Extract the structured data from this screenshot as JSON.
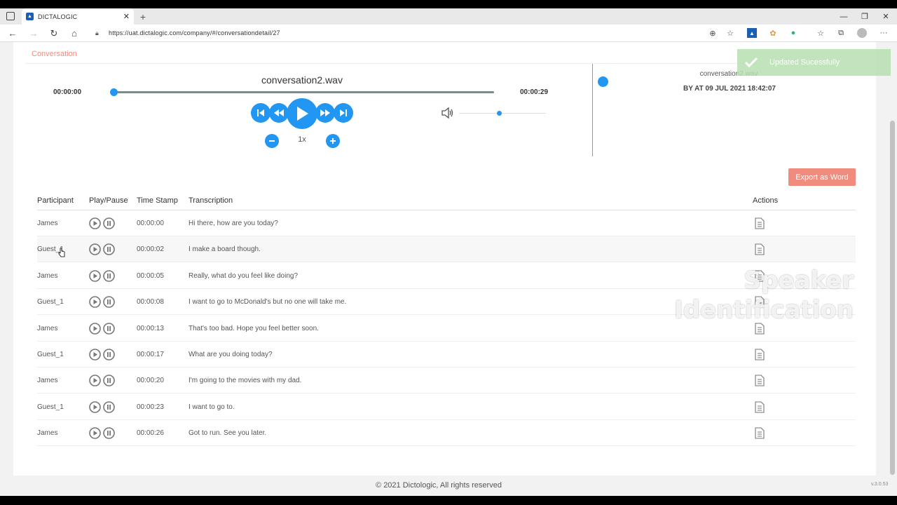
{
  "browser": {
    "tab_title": "DICTALOGIC",
    "url": "https://uat.dictalogic.com/company/#/conversationdetail/27"
  },
  "breadcrumb": "Conversation",
  "player": {
    "filename": "conversation2.wav",
    "current_time": "00:00:00",
    "total_time": "00:00:29",
    "progress_fraction": 0.0,
    "volume_fraction": 0.46,
    "speed": "1x"
  },
  "meta": {
    "file": "conversation2.wav",
    "by": "BY AT 09 JUL 2021 18:42:07"
  },
  "toast": {
    "message": "Updated Sucessfully"
  },
  "export_label": "Export as Word",
  "table": {
    "headers": {
      "participant": "Participant",
      "playpause": "Play/Pause",
      "timestamp": "Time Stamp",
      "transcription": "Transcription",
      "actions": "Actions"
    },
    "rows": [
      {
        "participant": "James",
        "timestamp": "00:00:00",
        "text": "Hi there, how are you today?"
      },
      {
        "participant": "Guest_1",
        "timestamp": "00:00:02",
        "text": "I make a board though."
      },
      {
        "participant": "James",
        "timestamp": "00:00:05",
        "text": "Really, what do you feel like doing?"
      },
      {
        "participant": "Guest_1",
        "timestamp": "00:00:08",
        "text": "I want to go to McDonald's but no one will take me."
      },
      {
        "participant": "James",
        "timestamp": "00:00:13",
        "text": "That's too bad. Hope you feel better soon."
      },
      {
        "participant": "Guest_1",
        "timestamp": "00:00:17",
        "text": "What are you doing today?"
      },
      {
        "participant": "James",
        "timestamp": "00:00:20",
        "text": "I'm going to the movies with my dad."
      },
      {
        "participant": "Guest_1",
        "timestamp": "00:00:23",
        "text": "I want to go to."
      },
      {
        "participant": "James",
        "timestamp": "00:00:26",
        "text": "Got to run. See you later."
      }
    ]
  },
  "watermark": {
    "line1": "Speaker",
    "line2": "Identification"
  },
  "footer": "© 2021 Dictologic, All rights reserved",
  "version": "v.3.0.53",
  "colors": {
    "accent": "#2196f3",
    "coral": "#f08c7e",
    "toast": "#b8e0b2"
  }
}
